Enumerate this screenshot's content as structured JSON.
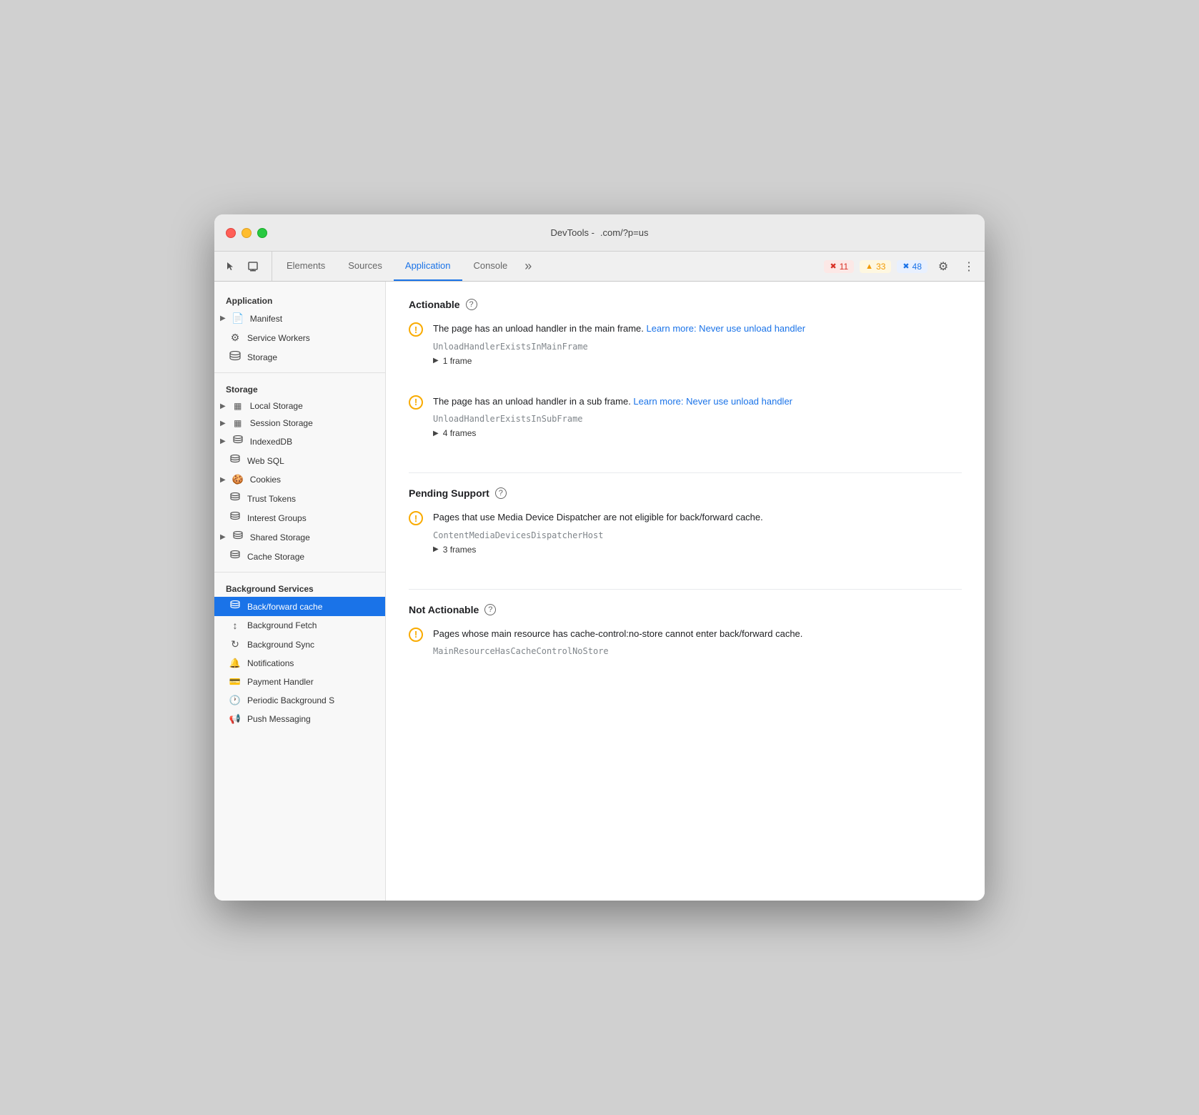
{
  "window": {
    "title_left": "DevTools -",
    "title_right": ".com/?p=us"
  },
  "tabbar": {
    "tabs": [
      {
        "id": "elements",
        "label": "Elements",
        "active": false
      },
      {
        "id": "sources",
        "label": "Sources",
        "active": false
      },
      {
        "id": "application",
        "label": "Application",
        "active": true
      },
      {
        "id": "console",
        "label": "Console",
        "active": false
      }
    ],
    "overflow_label": "»",
    "badges": [
      {
        "id": "error",
        "icon": "✖",
        "count": "11",
        "type": "error"
      },
      {
        "id": "warning",
        "icon": "▲",
        "count": "33",
        "type": "warning"
      },
      {
        "id": "info",
        "icon": "✖",
        "count": "48",
        "type": "info"
      }
    ],
    "settings_icon": "⚙",
    "more_icon": "⋮"
  },
  "sidebar": {
    "sections": [
      {
        "id": "application",
        "title": "Application",
        "items": [
          {
            "id": "manifest",
            "label": "Manifest",
            "icon": "▶",
            "icon2": "📄",
            "hasArrow": true
          },
          {
            "id": "service-workers",
            "label": "Service Workers",
            "icon": "⚙"
          },
          {
            "id": "storage",
            "label": "Storage",
            "icon": "🗄"
          }
        ]
      },
      {
        "id": "storage-section",
        "title": "Storage",
        "items": [
          {
            "id": "local-storage",
            "label": "Local Storage",
            "icon": "▶",
            "icon2": "▦",
            "hasArrow": true
          },
          {
            "id": "session-storage",
            "label": "Session Storage",
            "icon": "▶",
            "icon2": "▦",
            "hasArrow": true
          },
          {
            "id": "indexeddb",
            "label": "IndexedDB",
            "icon": "▶",
            "icon2": "🗄",
            "hasArrow": true
          },
          {
            "id": "web-sql",
            "label": "Web SQL",
            "icon": "🗄"
          },
          {
            "id": "cookies",
            "label": "Cookies",
            "icon": "▶",
            "icon2": "🍪",
            "hasArrow": true
          },
          {
            "id": "trust-tokens",
            "label": "Trust Tokens",
            "icon": "🗄"
          },
          {
            "id": "interest-groups",
            "label": "Interest Groups",
            "icon": "🗄"
          },
          {
            "id": "shared-storage",
            "label": "Shared Storage",
            "icon": "▶",
            "icon2": "🗄",
            "hasArrow": true
          },
          {
            "id": "cache-storage",
            "label": "Cache Storage",
            "icon": "🗄"
          }
        ]
      },
      {
        "id": "background-services",
        "title": "Background Services",
        "items": [
          {
            "id": "back-forward-cache",
            "label": "Back/forward cache",
            "icon": "🗄",
            "active": true
          },
          {
            "id": "background-fetch",
            "label": "Background Fetch",
            "icon": "↕"
          },
          {
            "id": "background-sync",
            "label": "Background Sync",
            "icon": "↻"
          },
          {
            "id": "notifications",
            "label": "Notifications",
            "icon": "🔔"
          },
          {
            "id": "payment-handler",
            "label": "Payment Handler",
            "icon": "💳"
          },
          {
            "id": "periodic-background",
            "label": "Periodic Background S",
            "icon": "🕐"
          },
          {
            "id": "push-messaging",
            "label": "Push Messaging",
            "icon": "📢"
          }
        ]
      }
    ]
  },
  "content": {
    "sections": [
      {
        "id": "actionable",
        "title": "Actionable",
        "issues": [
          {
            "id": "unload-main",
            "text_before": "The page has an unload handler in the main frame.",
            "link_text": "Learn more: Never use unload handler",
            "link_url": "#",
            "code": "UnloadHandlerExistsInMainFrame",
            "frames": "1 frame"
          },
          {
            "id": "unload-sub",
            "text_before": "The page has an unload handler in a sub frame.",
            "link_text": "Learn more: Never use unload handler",
            "link_url": "#",
            "code": "UnloadHandlerExistsInSubFrame",
            "frames": "4 frames"
          }
        ]
      },
      {
        "id": "pending-support",
        "title": "Pending Support",
        "issues": [
          {
            "id": "media-device",
            "text_before": "Pages that use Media Device Dispatcher are not eligible for back/forward cache.",
            "link_text": "",
            "link_url": "",
            "code": "ContentMediaDevicesDispatcherHost",
            "frames": "3 frames"
          }
        ]
      },
      {
        "id": "not-actionable",
        "title": "Not Actionable",
        "issues": [
          {
            "id": "cache-control",
            "text_before": "Pages whose main resource has cache-control:no-store cannot enter back/forward cache.",
            "link_text": "",
            "link_url": "",
            "code": "MainResourceHasCacheControlNoStore",
            "frames": ""
          }
        ]
      }
    ]
  }
}
